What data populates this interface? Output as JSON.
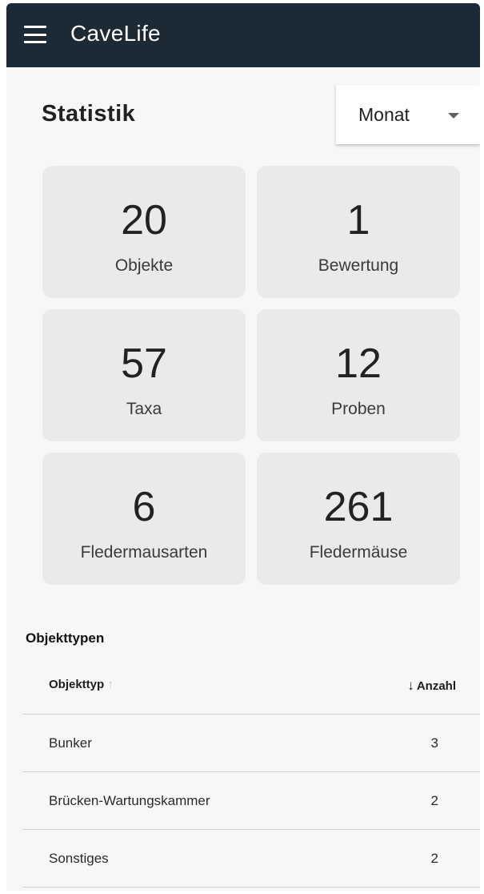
{
  "appbar": {
    "title": "CaveLife",
    "menu_icon": "hamburger-menu-icon",
    "background": "#1c2a36"
  },
  "page": {
    "heading": "Statistik",
    "period_select": {
      "value": "Monat",
      "icon": "dropdown-arrow-icon"
    }
  },
  "stats": [
    {
      "value": "20",
      "label": "Objekte"
    },
    {
      "value": "1",
      "label": "Bewertung"
    },
    {
      "value": "57",
      "label": "Taxa"
    },
    {
      "value": "12",
      "label": "Proben"
    },
    {
      "value": "6",
      "label": "Fledermausarten"
    },
    {
      "value": "261",
      "label": "Fledermäuse"
    }
  ],
  "object_types": {
    "heading": "Objekttypen",
    "columns": {
      "type": "Objekttyp",
      "type_sort_icon": "↑",
      "count": "Anzahl",
      "count_sort_icon": "↓"
    },
    "rows": [
      {
        "type": "Bunker",
        "count": "3"
      },
      {
        "type": "Brücken-Wartungskammer",
        "count": "2"
      },
      {
        "type": "Sonstiges",
        "count": "2"
      }
    ]
  }
}
